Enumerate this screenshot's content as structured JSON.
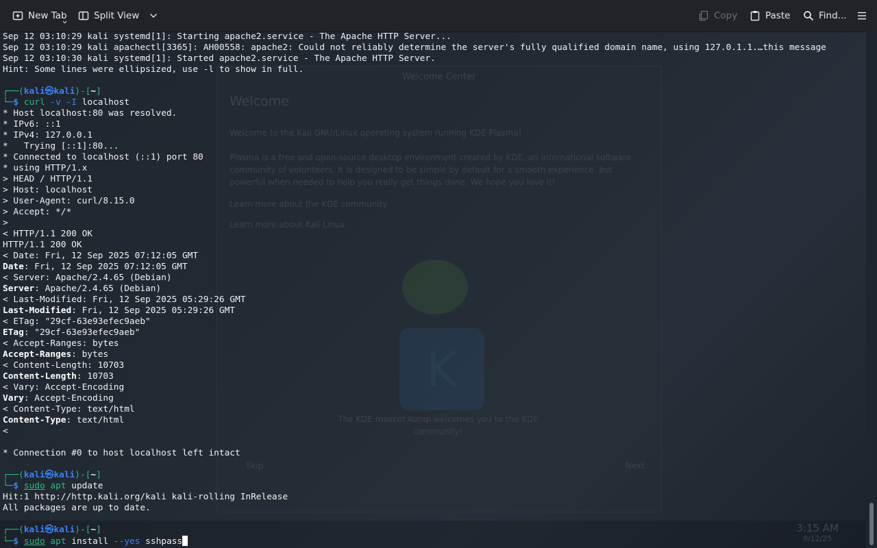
{
  "toolbar": {
    "new_tab_label": "New Tab",
    "split_view_label": "Split View",
    "copy_label": "Copy",
    "paste_label": "Paste",
    "find_label": "Find..."
  },
  "background": {
    "welcome_title": "Welcome",
    "welcome_window_title": "Welcome Center",
    "welcome_line1": "Welcome to the Kali GNU/Linux operating system running KDE Plasma!",
    "welcome_line2": "Plasma is a free and open-source desktop environment created by KDE, an international software",
    "welcome_line3": "community of volunteers. It is designed to be simple by default for a smooth experience, but",
    "welcome_line4": "powerful when needed to help you really get things done. We hope you love it!",
    "link1": "Learn more about the KDE community",
    "link2": "Learn more about Kali Linux",
    "mascot_caption1": "The KDE mascot Konqi welcomes you to the KDE",
    "mascot_caption2": "community!",
    "skip_label": "Skip",
    "next_label": "Next",
    "clock_time": "3:15 AM",
    "clock_date": "9/12/25"
  },
  "terminal": {
    "log1": "Sep 12 03:10:29 kali systemd[1]: Starting apache2.service - The Apache HTTP Server...",
    "log2": "Sep 12 03:10:29 kali apachectl[3365]: AH00558: apache2: Could not reliably determine the server's fully qualified domain name, using 127.0.1.1.…this message",
    "log3": "Sep 12 03:10:30 kali systemd[1]: Started apache2.service - The Apache HTTP Server.",
    "log4": "Hint: Some lines were ellipsized, use -l to show in full.",
    "prompt_user": "kali",
    "prompt_at": "㉿",
    "prompt_host": "kali",
    "prompt_dir": "~",
    "cmd1": {
      "program": "curl",
      "flags": "-v -I",
      "arg": "localhost"
    },
    "curl_lines": [
      "* Host localhost:80 was resolved.",
      "* IPv6: ::1",
      "* IPv4: 127.0.0.1",
      "*   Trying [::1]:80...",
      "* Connected to localhost (::1) port 80",
      "* using HTTP/1.x",
      "> HEAD / HTTP/1.1",
      "> Host: localhost",
      "> User-Agent: curl/8.15.0",
      "> Accept: */*",
      ">",
      "< HTTP/1.1 200 OK",
      "HTTP/1.1 200 OK",
      "< Date: Fri, 12 Sep 2025 07:12:05 GMT"
    ],
    "headers": [
      {
        "bold_key": "Date",
        "value": ": Fri, 12 Sep 2025 07:12:05 GMT"
      },
      {
        "raw": "< Server: Apache/2.4.65 (Debian)"
      },
      {
        "bold_key": "Server",
        "value": ": Apache/2.4.65 (Debian)"
      },
      {
        "raw": "< Last-Modified: Fri, 12 Sep 2025 05:29:26 GMT"
      },
      {
        "bold_key": "Last-Modified",
        "value": ": Fri, 12 Sep 2025 05:29:26 GMT"
      },
      {
        "raw": "< ETag: \"29cf-63e93efec9aeb\""
      },
      {
        "bold_key": "ETag",
        "value": ": \"29cf-63e93efec9aeb\""
      },
      {
        "raw": "< Accept-Ranges: bytes"
      },
      {
        "bold_key": "Accept-Ranges",
        "value": ": bytes"
      },
      {
        "raw": "< Content-Length: 10703"
      },
      {
        "bold_key": "Content-Length",
        "value": ": 10703"
      },
      {
        "raw": "< Vary: Accept-Encoding"
      },
      {
        "bold_key": "Vary",
        "value": ": Accept-Encoding"
      },
      {
        "raw": "< Content-Type: text/html"
      },
      {
        "bold_key": "Content-Type",
        "value": ": text/html"
      },
      {
        "raw": "<"
      }
    ],
    "conn_closed": "* Connection #0 to host localhost left intact",
    "cmd2": {
      "sudo": "sudo",
      "program": "apt",
      "arg": "update"
    },
    "apt_lines": [
      "Hit:1 http://http.kali.org/kali kali-rolling InRelease",
      "All packages are up to date."
    ],
    "cmd3": {
      "sudo": "sudo",
      "program": "apt",
      "arg1": "install",
      "flag": "--yes",
      "arg2": "sshpass"
    }
  }
}
